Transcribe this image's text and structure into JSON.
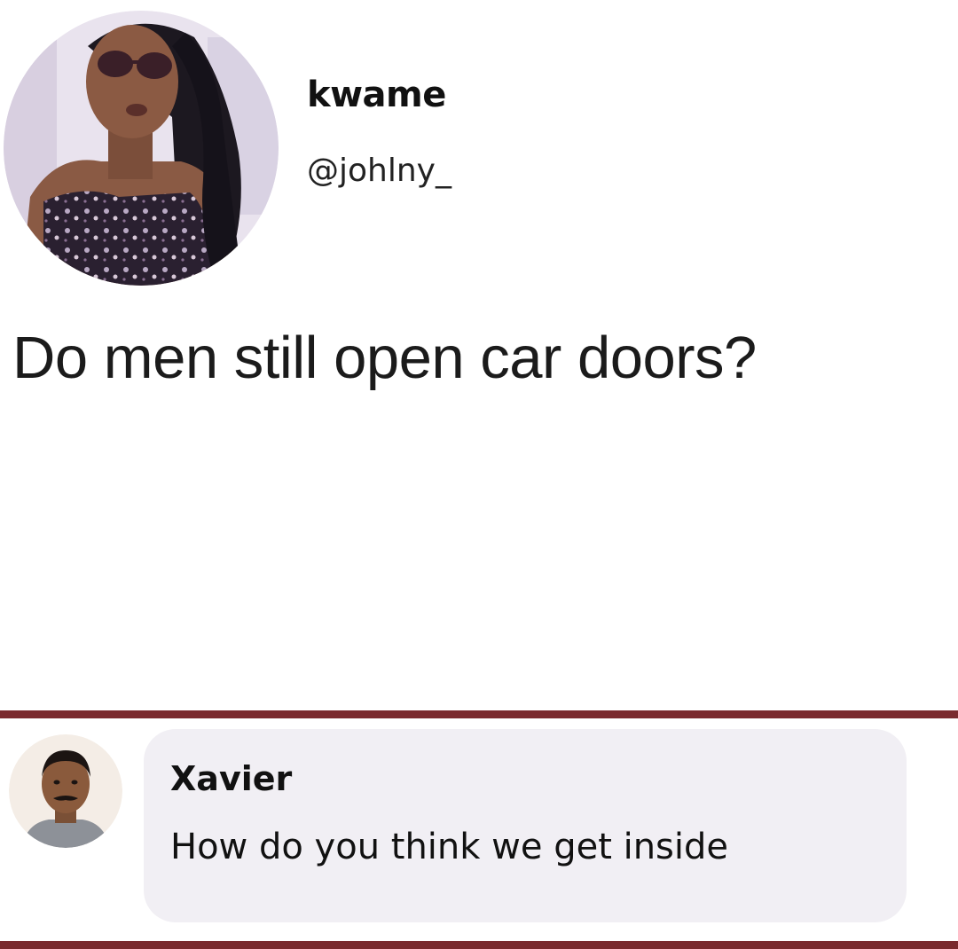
{
  "post": {
    "author_name": "kwame",
    "author_handle": "@johlny_",
    "text": "Do men still open car doors?",
    "avatar_icon": "profile-photo"
  },
  "comment": {
    "author_name": "Xavier",
    "text": "How do you think we get inside",
    "avatar_icon": "profile-photo"
  },
  "colors": {
    "divider": "#7a2a2e",
    "comment_bubble": "#f1eff4",
    "text": "#111111"
  }
}
